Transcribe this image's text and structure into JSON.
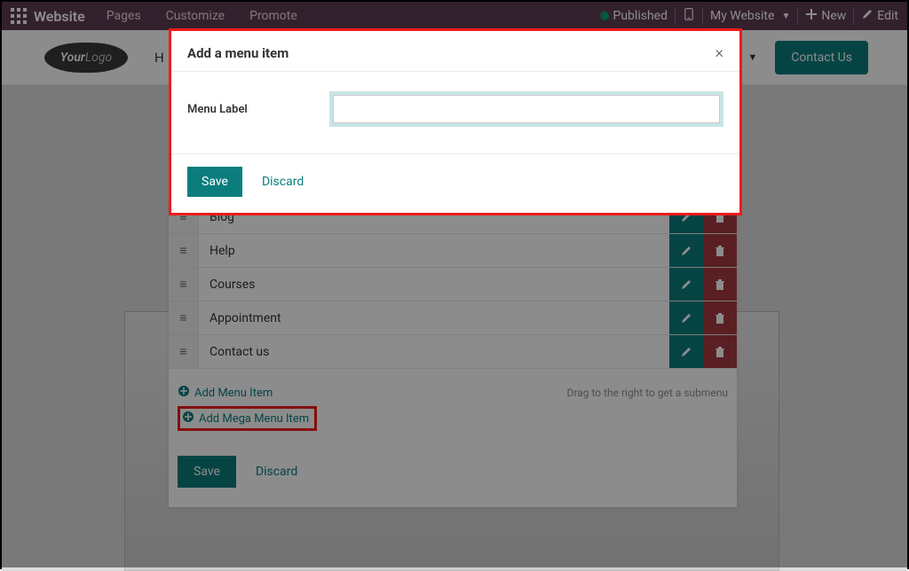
{
  "topbar": {
    "title": "Website",
    "links": [
      "Pages",
      "Customize",
      "Promote"
    ],
    "published": "Published",
    "website_switcher": "My Website",
    "new": "New",
    "edit": "Edit"
  },
  "siteheader": {
    "logo_text_a": "Your",
    "logo_text_b": "Logo",
    "nav_fragment": "H",
    "contact_label": "Contact Us"
  },
  "menu_panel": {
    "rows": [
      {
        "label": "Blog"
      },
      {
        "label": "Help"
      },
      {
        "label": "Courses"
      },
      {
        "label": "Appointment"
      },
      {
        "label": "Contact us"
      }
    ],
    "add_item": "Add Menu Item",
    "add_mega": "Add Mega Menu Item",
    "hint": "Drag to the right to get a submenu",
    "save": "Save",
    "discard": "Discard"
  },
  "modal": {
    "title": "Add a menu item",
    "label": "Menu Label",
    "input_value": "",
    "save": "Save",
    "discard": "Discard"
  }
}
